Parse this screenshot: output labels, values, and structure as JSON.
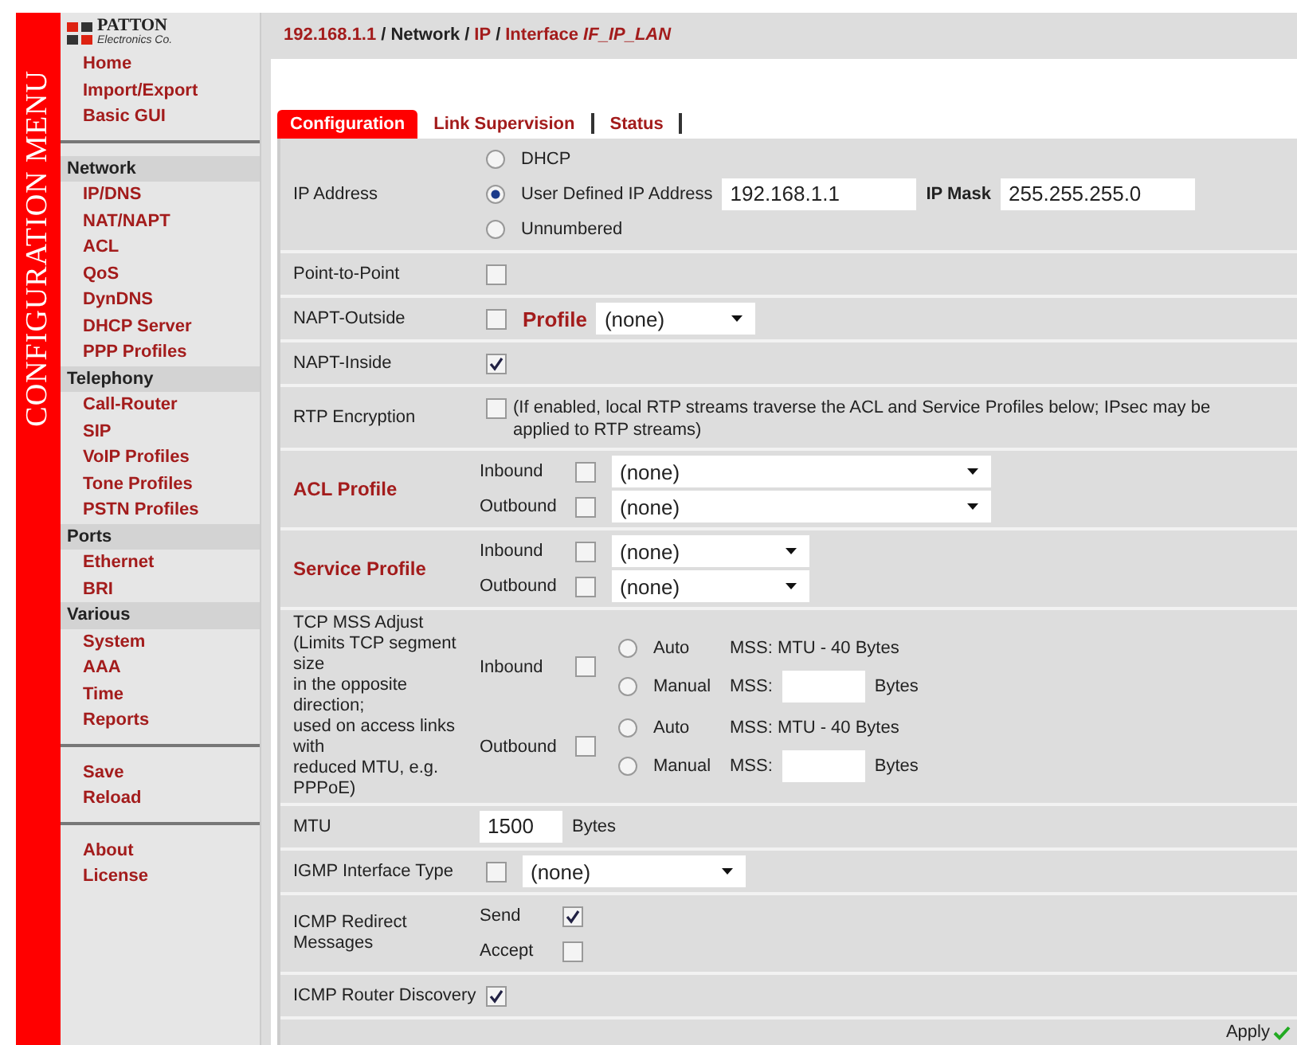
{
  "logo": {
    "name": "PATTON",
    "tagline": "Electronics Co."
  },
  "menu_title": "CONFIGURATION MENU",
  "sidebar": {
    "blocks": [
      {
        "groups": [
          {
            "items": [
              "Home",
              "Import/Export",
              "Basic GUI"
            ]
          }
        ]
      },
      {
        "groups": [
          {
            "heading": "Network",
            "items": [
              "IP/DNS",
              "NAT/NAPT",
              "ACL",
              "QoS",
              "DynDNS",
              "DHCP Server",
              "PPP Profiles"
            ]
          },
          {
            "heading": "Telephony",
            "items": [
              "Call-Router",
              "SIP",
              "VoIP Profiles",
              "Tone Profiles",
              "PSTN Profiles"
            ]
          },
          {
            "heading": "Ports",
            "items": [
              "Ethernet",
              "BRI"
            ]
          },
          {
            "heading": "Various",
            "items": [
              "System",
              "AAA",
              "Time",
              "Reports"
            ]
          }
        ]
      },
      {
        "groups": [
          {
            "items": [
              "Save",
              "Reload"
            ]
          }
        ]
      },
      {
        "groups": [
          {
            "items": [
              "About",
              "License"
            ]
          }
        ]
      }
    ]
  },
  "breadcrumb": {
    "separator": "/",
    "parts": [
      {
        "text": "192.168.1.1",
        "link": true
      },
      {
        "text": "Network",
        "link": false
      },
      {
        "text": "IP",
        "link": true
      },
      {
        "text": "Interface *IF_IP_LAN*",
        "link": true
      }
    ]
  },
  "tabs": [
    {
      "label": "Configuration",
      "selected": true
    },
    {
      "label": "Link Supervision",
      "selected": false
    },
    {
      "label": "Status",
      "selected": false
    }
  ],
  "rows": [
    {
      "kind": "ip",
      "label": "IP Address",
      "options": [
        {
          "label": "DHCP",
          "selected": false
        },
        {
          "label": "User Defined IP Address",
          "selected": true,
          "value": "192.168.1.1",
          "mask_label": "IP Mask",
          "mask_value": "255.255.255.0"
        },
        {
          "label": "Unnumbered",
          "selected": false
        }
      ]
    },
    {
      "kind": "check",
      "label": "Point-to-Point",
      "checked": false
    },
    {
      "kind": "napt",
      "label": "NAPT-Outside",
      "checked": false,
      "profile_label": "Profile",
      "select": "(none)"
    },
    {
      "kind": "check",
      "label": "NAPT-Inside",
      "checked": true
    },
    {
      "kind": "note",
      "label": "RTP Encryption",
      "checked": false,
      "note": "(If enabled, local RTP streams traverse the ACL and Service Profiles below; IPsec may be applied to RTP streams)"
    },
    {
      "kind": "acl",
      "label": "ACL Profile",
      "lines": [
        {
          "label": "Inbound",
          "checked": false,
          "select": "(none)"
        },
        {
          "label": "Outbound",
          "checked": false,
          "select": "(none)"
        }
      ]
    },
    {
      "kind": "service",
      "label": "Service Profile",
      "lines": [
        {
          "label": "Inbound",
          "checked": false,
          "select": "(none)"
        },
        {
          "label": "Outbound",
          "checked": false,
          "select": "(none)"
        }
      ]
    },
    {
      "kind": "mss",
      "label_lines": [
        "TCP MSS Adjust",
        "(Limits TCP segment",
        "size",
        "in the opposite",
        "direction;",
        "used on access links",
        "with",
        "reduced MTU, e.g.",
        "PPPoE)"
      ],
      "directions": [
        {
          "label": "Inbound",
          "checked": false,
          "options": [
            {
              "label": "Auto",
              "selected": false,
              "text": "MSS: MTU - 40 Bytes"
            },
            {
              "label": "Manual",
              "selected": false,
              "field_label": "MSS:",
              "unit": "Bytes"
            }
          ]
        },
        {
          "label": "Outbound",
          "checked": false,
          "options": [
            {
              "label": "Auto",
              "selected": false,
              "text": "MSS: MTU - 40 Bytes"
            },
            {
              "label": "Manual",
              "selected": false,
              "field_label": "MSS:",
              "unit": "Bytes"
            }
          ]
        }
      ]
    },
    {
      "kind": "unit",
      "label": "MTU",
      "value": "1500",
      "unit": "Bytes"
    },
    {
      "kind": "checkselect",
      "label": "IGMP Interface Type",
      "checked": false,
      "select": "(none)"
    },
    {
      "kind": "checks",
      "label": "ICMP Redirect Messages",
      "lines": [
        {
          "label": "Send",
          "checked": true
        },
        {
          "label": "Accept",
          "checked": false
        }
      ]
    },
    {
      "kind": "check",
      "label": "ICMP Router Discovery",
      "checked": true
    }
  ],
  "apply": {
    "label": "Apply"
  }
}
